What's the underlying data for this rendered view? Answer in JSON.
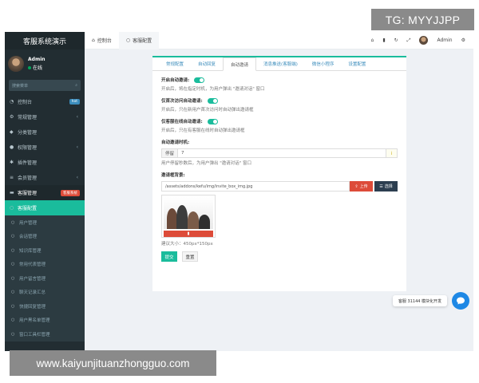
{
  "sidebar": {
    "brand": "客服系统演示",
    "user": {
      "name": "Admin",
      "status": "在线"
    },
    "search_placeholder": "搜索菜单",
    "menu": [
      {
        "label": "控制台",
        "icon": "dashboard-icon",
        "badge": "hot",
        "badge_color": "#3c8dbc"
      },
      {
        "label": "常规管理",
        "icon": "cog-icon",
        "chevron": "‹"
      },
      {
        "label": "分类管理",
        "icon": "tag-icon"
      },
      {
        "label": "权限管理",
        "icon": "group-icon",
        "chevron": "‹"
      },
      {
        "label": "插件管理",
        "icon": "puzzle-icon"
      },
      {
        "label": "会员管理",
        "icon": "list-icon",
        "chevron": "‹"
      },
      {
        "label": "客服管理",
        "icon": "chat-icon",
        "badge": "客服系统",
        "badge_color": "#dd4b39"
      }
    ],
    "submenu": [
      {
        "label": "客服配置",
        "active": true
      },
      {
        "label": "用户管理"
      },
      {
        "label": "会话管理"
      },
      {
        "label": "知识库管理"
      },
      {
        "label": "常用代表管理"
      },
      {
        "label": "用户留言管理"
      },
      {
        "label": "聊天记录汇总"
      },
      {
        "label": "快捷回复管理"
      },
      {
        "label": "用户黑名单管理"
      },
      {
        "label": "窗口工具栏管理"
      }
    ]
  },
  "topbar": {
    "tabs": [
      {
        "label": "控制台",
        "icon": "home-icon"
      },
      {
        "label": "客服配置",
        "icon": "circle-icon",
        "active": true
      }
    ],
    "admin_label": "Admin"
  },
  "panel": {
    "tabs": [
      "常规配置",
      "自动回复",
      "自动邀请",
      "消息推送(客服端)",
      "微信小程序",
      "设置配置"
    ],
    "active_tab": "自动邀请",
    "fields": {
      "auto_invite_label": "开启自动邀请:",
      "auto_invite_help": "开启后，将在指定时机，为用户弹出 \"邀请对话\" 窗口",
      "first_visit_label": "仅首次访问自动邀请:",
      "first_visit_help": "开启后，只在新用户首次访问时自动弹出邀请框",
      "online_only_label": "仅客服在线自动邀请:",
      "online_only_help": "开启后，只在有客服在线时自动弹出邀请框",
      "timing_label": "自动邀请时机:",
      "timing_addon": "停留",
      "timing_value": "7",
      "timing_help": "用户停留秒数后，为用户弹出 \"邀请对话\" 窗口",
      "bg_label": "邀请框背景:",
      "bg_path": "/assets/addons/kefu/img/invite_box_img.jpg",
      "upload_label": "上传",
      "choose_label": "选择",
      "delete_label": "",
      "size_note": "建议大小：450px*150px",
      "submit_label": "提交",
      "reset_label": "重置"
    }
  },
  "chat": {
    "pill_text": "客服 31144 模块化开发"
  },
  "watermarks": {
    "top": "TG: MYYJJPP",
    "bottom": "www.kaiyunjituanzhongguo.com"
  }
}
